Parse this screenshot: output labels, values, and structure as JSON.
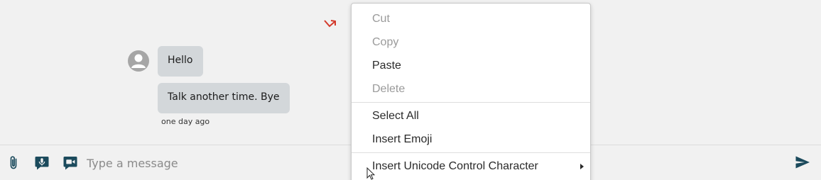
{
  "conversation": {
    "messages": [
      {
        "text": "Hello"
      },
      {
        "text": "Talk another time. Bye"
      }
    ],
    "timestamp": "one day ago"
  },
  "composer": {
    "placeholder": "Type a message"
  },
  "context_menu": {
    "items": [
      {
        "label": "Cut",
        "enabled": false
      },
      {
        "label": "Copy",
        "enabled": false
      },
      {
        "label": "Paste",
        "enabled": true
      },
      {
        "label": "Delete",
        "enabled": false
      },
      {
        "label": "Select All",
        "enabled": true
      },
      {
        "label": "Insert Emoji",
        "enabled": true
      },
      {
        "label": "Insert Unicode Control Character",
        "enabled": true,
        "has_submenu": true
      }
    ]
  },
  "icons": {
    "status": "arrow-up-right-icon",
    "avatar": "person-icon",
    "attach": "paperclip-icon",
    "voice": "microphone-icon",
    "video": "video-message-icon",
    "send": "send-icon"
  },
  "colors": {
    "background": "#f1f1f1",
    "bubble": "#d3d7da",
    "icon": "#1b4a5c",
    "missed_arrow": "#d33a2c",
    "disabled_text": "#9a9a9a"
  }
}
